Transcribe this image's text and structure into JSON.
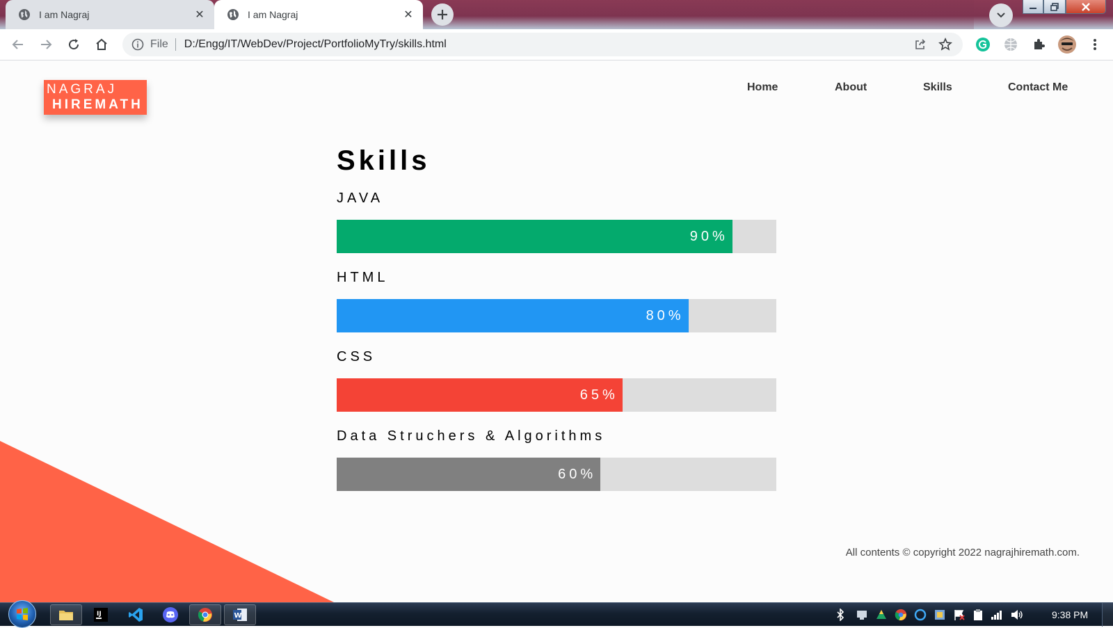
{
  "browser": {
    "tabs": [
      {
        "title": "I am Nagraj",
        "active": false
      },
      {
        "title": "I am Nagraj",
        "active": true
      }
    ],
    "address": {
      "scheme_label": "File",
      "url": "D:/Engg/IT/WebDev/Project/PortfolioMyTry/skills.html"
    }
  },
  "page": {
    "logo": {
      "line1": "NAGRAJ",
      "line2": "HIREMATH"
    },
    "nav": [
      "Home",
      "About",
      "Skills",
      "Contact Me"
    ],
    "heading": "Skills",
    "skills": [
      {
        "name": "JAVA",
        "percent_label": "90%",
        "percent": 90,
        "color": "#04aa6d"
      },
      {
        "name": "HTML",
        "percent_label": "80%",
        "percent": 80,
        "color": "#2196f3"
      },
      {
        "name": "CSS",
        "percent_label": "65%",
        "percent": 65,
        "color": "#f44336"
      },
      {
        "name": "Data Struchers & Algorithms",
        "percent_label": "60%",
        "percent": 60,
        "color": "#808080"
      }
    ],
    "footer": "All contents © copyright 2022 nagrajhiremath.com.",
    "accent_color": "#ff6347",
    "track_color": "#dddddd"
  },
  "taskbar": {
    "clock": "9:38 PM",
    "apps": [
      "file-explorer-icon",
      "intellij-icon",
      "vscode-icon",
      "discord-icon",
      "chrome-icon",
      "word-icon"
    ]
  }
}
